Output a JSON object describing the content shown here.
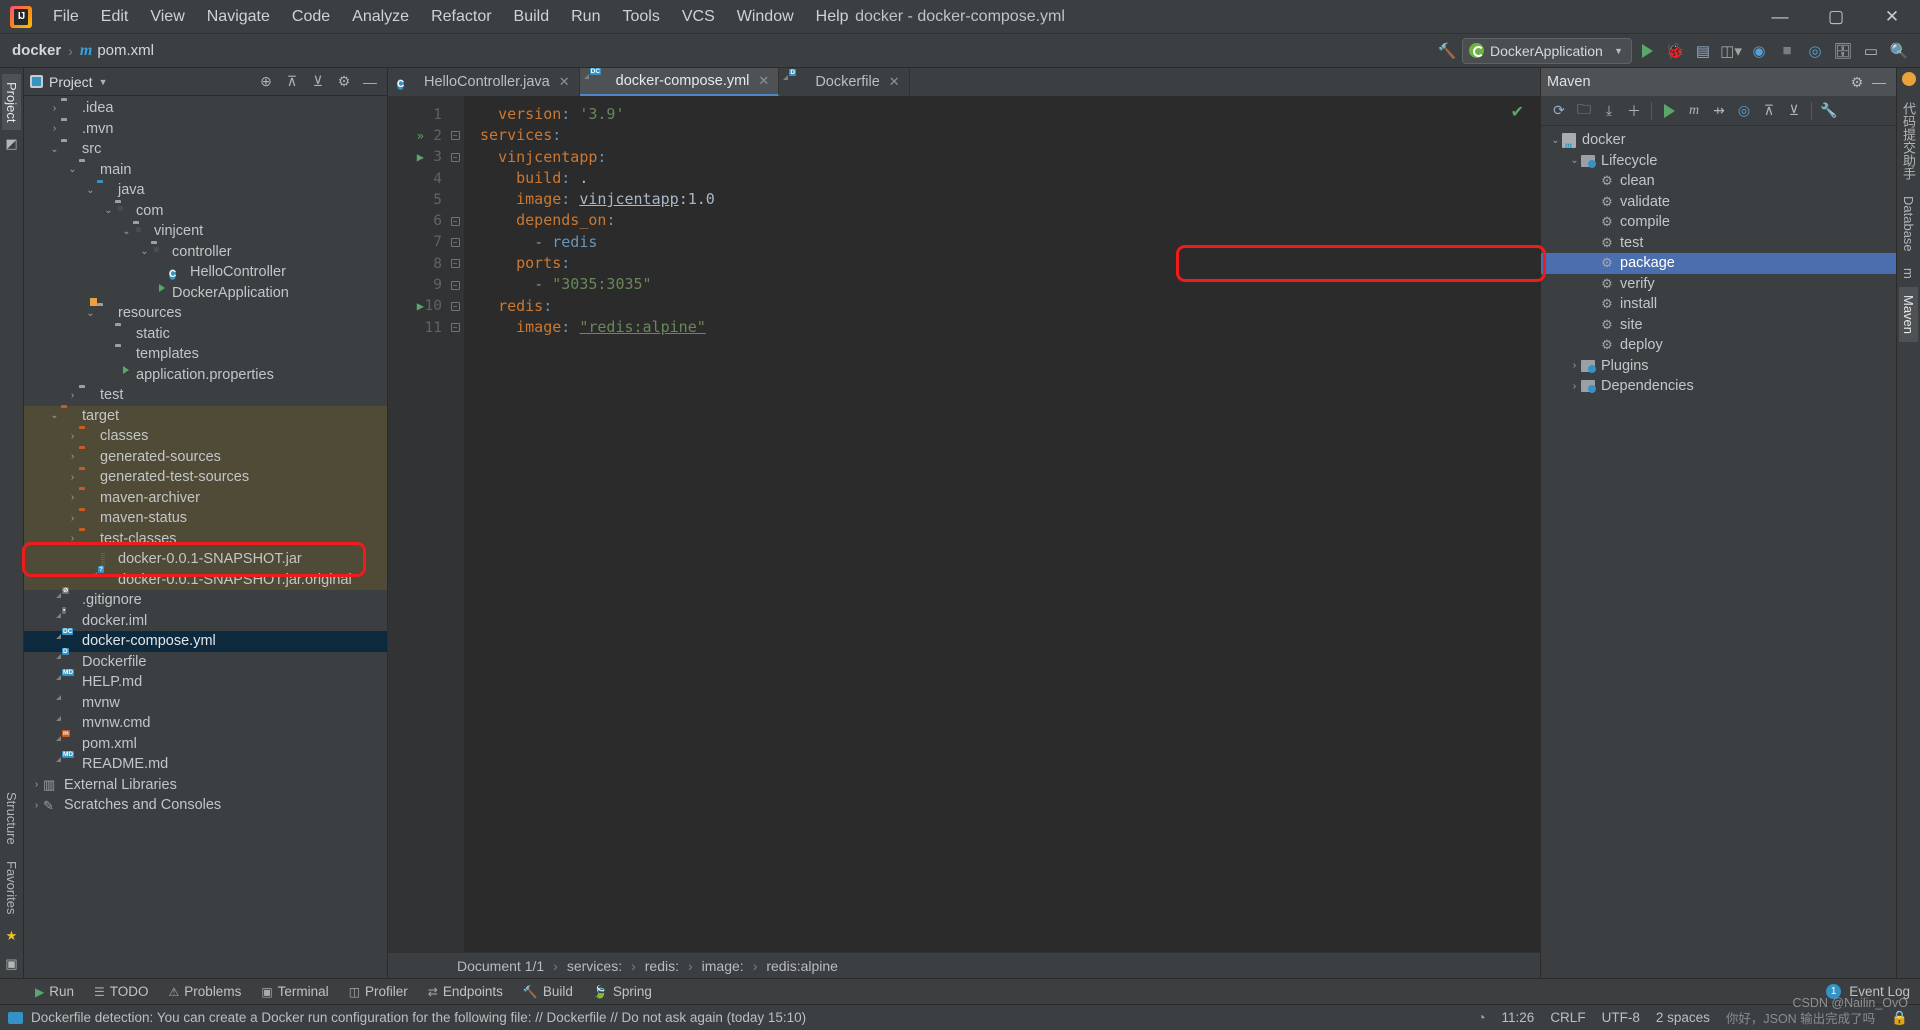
{
  "window": {
    "title": "docker - docker-compose.yml",
    "controls": {
      "minimize": "—",
      "maximize": "▢",
      "close": "✕"
    }
  },
  "menubar": {
    "items": [
      {
        "label": "File"
      },
      {
        "label": "Edit"
      },
      {
        "label": "View"
      },
      {
        "label": "Navigate"
      },
      {
        "label": "Code"
      },
      {
        "label": "Analyze"
      },
      {
        "label": "Refactor"
      },
      {
        "label": "Build"
      },
      {
        "label": "Run"
      },
      {
        "label": "Tools"
      },
      {
        "label": "VCS"
      },
      {
        "label": "Window"
      },
      {
        "label": "Help"
      }
    ]
  },
  "navbar": {
    "breadcrumb": [
      {
        "label": "docker",
        "icon": ""
      },
      {
        "label": "pom.xml",
        "icon": "maven-m-icon"
      }
    ],
    "separator": "›",
    "run_config": "DockerApplication",
    "icons": [
      "hammer-build-icon",
      "run-icon",
      "debug-icon",
      "run-coverage-icon",
      "profiler-icon",
      "stop-icon",
      "updates-icon",
      "services-icon",
      "layout-icon",
      "search-icon"
    ]
  },
  "left_rail": {
    "tabs": [
      {
        "label": "Project",
        "selected": true
      }
    ],
    "bottom": [
      {
        "label": "Structure"
      },
      {
        "label": "Favorites"
      }
    ]
  },
  "project_panel": {
    "title": "Project",
    "header_icons": [
      "locate-icon",
      "expand-all-icon",
      "collapse-all-icon",
      "gear-icon",
      "hide-icon"
    ],
    "tree": [
      {
        "label": ".idea",
        "depth": 1,
        "arrow": "›",
        "icon": "folder",
        "color": "gray"
      },
      {
        "label": ".mvn",
        "depth": 1,
        "arrow": "›",
        "icon": "folder",
        "color": "gray"
      },
      {
        "label": "src",
        "depth": 1,
        "arrow": "∨",
        "icon": "folder",
        "color": "gray"
      },
      {
        "label": "main",
        "depth": 2,
        "arrow": "∨",
        "icon": "folder",
        "color": "gray"
      },
      {
        "label": "java",
        "depth": 3,
        "arrow": "∨",
        "icon": "folder",
        "color": "blue"
      },
      {
        "label": "com",
        "depth": 4,
        "arrow": "∨",
        "icon": "package",
        "color": "gray"
      },
      {
        "label": "vinjcent",
        "depth": 5,
        "arrow": "∨",
        "icon": "package",
        "color": "gray"
      },
      {
        "label": "controller",
        "depth": 6,
        "arrow": "∨",
        "icon": "package",
        "color": "gray"
      },
      {
        "label": "HelloController",
        "depth": 7,
        "arrow": "",
        "icon": "class",
        "color": ""
      },
      {
        "label": "DockerApplication",
        "depth": 6,
        "arrow": "",
        "icon": "spring-class",
        "color": ""
      },
      {
        "label": "resources",
        "depth": 3,
        "arrow": "∨",
        "icon": "resources-folder",
        "color": "gray"
      },
      {
        "label": "static",
        "depth": 4,
        "arrow": "",
        "icon": "folder",
        "color": "gray"
      },
      {
        "label": "templates",
        "depth": 4,
        "arrow": "",
        "icon": "folder",
        "color": "gray"
      },
      {
        "label": "application.properties",
        "depth": 4,
        "arrow": "",
        "icon": "spring-properties",
        "color": ""
      },
      {
        "label": "test",
        "depth": 2,
        "arrow": "›",
        "icon": "folder",
        "color": "gray"
      },
      {
        "label": "target",
        "depth": 1,
        "arrow": "∨",
        "icon": "folder",
        "color": "orange",
        "bg": "target"
      },
      {
        "label": "classes",
        "depth": 2,
        "arrow": "›",
        "icon": "folder",
        "color": "orange",
        "bg": "target"
      },
      {
        "label": "generated-sources",
        "depth": 2,
        "arrow": "›",
        "icon": "folder",
        "color": "orange",
        "bg": "target"
      },
      {
        "label": "generated-test-sources",
        "depth": 2,
        "arrow": "›",
        "icon": "folder",
        "color": "orange",
        "bg": "target"
      },
      {
        "label": "maven-archiver",
        "depth": 2,
        "arrow": "›",
        "icon": "folder",
        "color": "orange",
        "bg": "target"
      },
      {
        "label": "maven-status",
        "depth": 2,
        "arrow": "›",
        "icon": "folder",
        "color": "orange",
        "bg": "target"
      },
      {
        "label": "test-classes",
        "depth": 2,
        "arrow": "›",
        "icon": "folder",
        "color": "orange",
        "bg": "target"
      },
      {
        "label": "docker-0.0.1-SNAPSHOT.jar",
        "depth": 3,
        "arrow": "",
        "icon": "jar",
        "color": "",
        "bg": "target",
        "highlight": true
      },
      {
        "label": "docker-0.0.1-SNAPSHOT.jar.original",
        "depth": 3,
        "arrow": "",
        "icon": "file-unknown",
        "color": "",
        "bg": "target"
      },
      {
        "label": ".gitignore",
        "depth": 1,
        "arrow": "",
        "icon": "gitignore",
        "color": ""
      },
      {
        "label": "docker.iml",
        "depth": 1,
        "arrow": "",
        "icon": "iml",
        "color": ""
      },
      {
        "label": "docker-compose.yml",
        "depth": 1,
        "arrow": "",
        "icon": "docker-compose",
        "color": "",
        "selected": true
      },
      {
        "label": "Dockerfile",
        "depth": 1,
        "arrow": "",
        "icon": "dockerfile",
        "color": ""
      },
      {
        "label": "HELP.md",
        "depth": 1,
        "arrow": "",
        "icon": "markdown",
        "color": ""
      },
      {
        "label": "mvnw",
        "depth": 1,
        "arrow": "",
        "icon": "file",
        "color": ""
      },
      {
        "label": "mvnw.cmd",
        "depth": 1,
        "arrow": "",
        "icon": "file",
        "color": ""
      },
      {
        "label": "pom.xml",
        "depth": 1,
        "arrow": "",
        "icon": "maven-pom",
        "color": ""
      },
      {
        "label": "README.md",
        "depth": 1,
        "arrow": "",
        "icon": "markdown",
        "color": ""
      },
      {
        "label": "External Libraries",
        "depth": 0,
        "arrow": "›",
        "icon": "libraries",
        "color": ""
      },
      {
        "label": "Scratches and Consoles",
        "depth": 0,
        "arrow": "›",
        "icon": "scratches",
        "color": ""
      }
    ]
  },
  "editor": {
    "tabs": [
      {
        "label": "HelloController.java",
        "icon": "java-class-icon",
        "active": false,
        "closable": true
      },
      {
        "label": "docker-compose.yml",
        "icon": "docker-compose-icon",
        "active": true,
        "closable": true
      },
      {
        "label": "Dockerfile",
        "icon": "dockerfile-icon",
        "active": false,
        "closable": true
      }
    ],
    "lines": [
      {
        "n": "1",
        "run": "",
        "fold": "",
        "indent": 1,
        "tokens": [
          {
            "t": "version",
            "c": "key"
          },
          {
            "t": ":",
            "c": "punc"
          },
          {
            "t": " ",
            "c": "val"
          },
          {
            "t": "'3.9'",
            "c": "str"
          }
        ]
      },
      {
        "n": "2",
        "run": "»",
        "fold": "-",
        "indent": 0,
        "tokens": [
          {
            "t": "services",
            "c": "key"
          },
          {
            "t": ":",
            "c": "punc"
          }
        ]
      },
      {
        "n": "3",
        "run": "▶",
        "fold": "-",
        "indent": 1,
        "tokens": [
          {
            "t": "vinjcentapp",
            "c": "key"
          },
          {
            "t": ":",
            "c": "punc"
          }
        ]
      },
      {
        "n": "4",
        "run": "",
        "fold": "",
        "indent": 2,
        "tokens": [
          {
            "t": "build",
            "c": "key"
          },
          {
            "t": ":",
            "c": "punc"
          },
          {
            "t": " .",
            "c": "val"
          }
        ]
      },
      {
        "n": "5",
        "run": "",
        "fold": "",
        "indent": 2,
        "tokens": [
          {
            "t": "image",
            "c": "key"
          },
          {
            "t": ":",
            "c": "punc"
          },
          {
            "t": " ",
            "c": "val"
          },
          {
            "t": "vinjcentapp",
            "c": "link"
          },
          {
            "t": ":1.0",
            "c": "val"
          }
        ]
      },
      {
        "n": "6",
        "run": "",
        "fold": "-",
        "indent": 2,
        "tokens": [
          {
            "t": "depends_on",
            "c": "key"
          },
          {
            "t": ":",
            "c": "punc"
          }
        ]
      },
      {
        "n": "7",
        "run": "",
        "fold": "^",
        "indent": 3,
        "tokens": [
          {
            "t": "- ",
            "c": "ref"
          },
          {
            "t": "redis",
            "c": "ref"
          }
        ]
      },
      {
        "n": "8",
        "run": "",
        "fold": "-",
        "indent": 2,
        "tokens": [
          {
            "t": "ports",
            "c": "key"
          },
          {
            "t": ":",
            "c": "punc"
          }
        ]
      },
      {
        "n": "9",
        "run": "",
        "fold": "^",
        "indent": 3,
        "tokens": [
          {
            "t": "- ",
            "c": "ref"
          },
          {
            "t": "\"3035:3035\"",
            "c": "str"
          }
        ]
      },
      {
        "n": "10",
        "run": "▶",
        "fold": "-",
        "indent": 1,
        "tokens": [
          {
            "t": "redis",
            "c": "key"
          },
          {
            "t": ":",
            "c": "punc"
          }
        ]
      },
      {
        "n": "11",
        "run": "",
        "fold": "^",
        "indent": 2,
        "tokens": [
          {
            "t": "image",
            "c": "key"
          },
          {
            "t": ":",
            "c": "punc"
          },
          {
            "t": " ",
            "c": "val"
          },
          {
            "t": "\"redis:alpine\"",
            "c": "strlink"
          }
        ]
      }
    ],
    "inspection_status": "✔",
    "bottom_breadcrumb": [
      "Document 1/1",
      "services:",
      "redis:",
      "image:",
      "redis:alpine"
    ]
  },
  "maven_panel": {
    "title": "Maven",
    "header_icons": [
      "gear-icon",
      "hide-icon"
    ],
    "toolbar_icons": [
      "reload-icon",
      "add-folder-icon",
      "download-sources-icon",
      "add-icon",
      "run-icon",
      "execute-goal-icon",
      "skip-tests-icon",
      "offline-icon",
      "expand-icon",
      "collapse-icon",
      "settings-icon"
    ],
    "tree": [
      {
        "label": "docker",
        "depth": 0,
        "arrow": "∨",
        "icon": "maven-project"
      },
      {
        "label": "Lifecycle",
        "depth": 1,
        "arrow": "∨",
        "icon": "lifecycle-folder"
      },
      {
        "label": "clean",
        "depth": 2,
        "arrow": "",
        "icon": "goal"
      },
      {
        "label": "validate",
        "depth": 2,
        "arrow": "",
        "icon": "goal"
      },
      {
        "label": "compile",
        "depth": 2,
        "arrow": "",
        "icon": "goal"
      },
      {
        "label": "test",
        "depth": 2,
        "arrow": "",
        "icon": "goal"
      },
      {
        "label": "package",
        "depth": 2,
        "arrow": "",
        "icon": "goal",
        "selected": true,
        "highlight": true
      },
      {
        "label": "verify",
        "depth": 2,
        "arrow": "",
        "icon": "goal"
      },
      {
        "label": "install",
        "depth": 2,
        "arrow": "",
        "icon": "goal"
      },
      {
        "label": "site",
        "depth": 2,
        "arrow": "",
        "icon": "goal"
      },
      {
        "label": "deploy",
        "depth": 2,
        "arrow": "",
        "icon": "goal"
      },
      {
        "label": "Plugins",
        "depth": 1,
        "arrow": "›",
        "icon": "plugins-folder"
      },
      {
        "label": "Dependencies",
        "depth": 1,
        "arrow": "›",
        "icon": "dependencies-folder"
      }
    ]
  },
  "right_rail": {
    "tabs": [
      {
        "label": "代码提交助手"
      },
      {
        "label": "Database"
      },
      {
        "label": "m"
      },
      {
        "label": "Maven",
        "selected": true
      }
    ]
  },
  "bottom_bar": {
    "items": [
      {
        "label": "Run",
        "icon": "run-icon"
      },
      {
        "label": "TODO",
        "icon": "todo-icon"
      },
      {
        "label": "Problems",
        "icon": "problems-icon"
      },
      {
        "label": "Terminal",
        "icon": "terminal-icon"
      },
      {
        "label": "Profiler",
        "icon": "profiler-icon"
      },
      {
        "label": "Endpoints",
        "icon": "endpoints-icon"
      },
      {
        "label": "Build",
        "icon": "build-icon"
      },
      {
        "label": "Spring",
        "icon": "spring-icon"
      }
    ],
    "event_log": "Event Log",
    "event_count": "1"
  },
  "statusbar": {
    "message": "Dockerfile detection: You can create a Docker run configuration for the following file: // Dockerfile // Do not ask again (today 15:10)",
    "time": "11:26",
    "line_separator": "CRLF",
    "encoding": "UTF-8",
    "indent": "2 spaces",
    "branch": "你好，JSON 输出完成了吗",
    "watermark": "CSDN @Nailin_OvO"
  }
}
